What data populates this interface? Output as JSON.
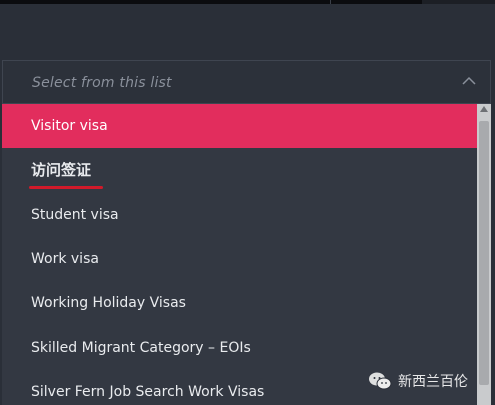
{
  "select": {
    "placeholder": "Select from this list"
  },
  "options": [
    {
      "label": "Visitor visa",
      "selected": true
    },
    {
      "label": "访问签证",
      "selected": false
    },
    {
      "label": "Student visa",
      "selected": false
    },
    {
      "label": "Work visa",
      "selected": false
    },
    {
      "label": "Working Holiday Visas",
      "selected": false
    },
    {
      "label": "Skilled Migrant Category – EOIs",
      "selected": false
    },
    {
      "label": "Silver Fern Job Search Work Visas",
      "selected": false
    }
  ],
  "watermark": {
    "text": "新西兰百伦",
    "icon": "wechat-icon"
  },
  "colors": {
    "selected_bg": "#e22d5d",
    "list_bg": "#333842",
    "annotation_underline": "#d11a2a"
  }
}
